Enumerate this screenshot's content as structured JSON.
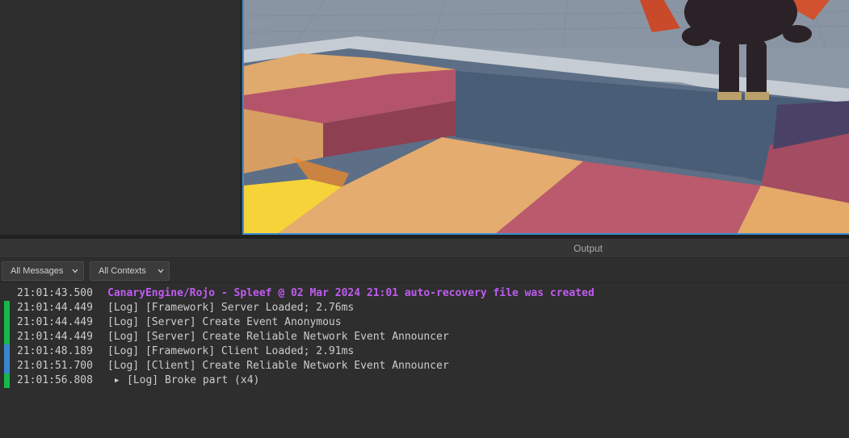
{
  "output": {
    "title": "Output",
    "filters": {
      "messages": "All Messages",
      "contexts": "All Contexts"
    },
    "logs": [
      {
        "time": "21:01:43.500",
        "text": "CanaryEngine/Rojo - Spleef @ 02 Mar 2024 21:01 auto-recovery file was created",
        "kind": "system",
        "bar": ""
      },
      {
        "time": "21:01:44.449",
        "text": "[Log] [Framework] Server Loaded; 2.76ms",
        "kind": "server",
        "bar": "#16b84a"
      },
      {
        "time": "21:01:44.449",
        "text": "[Log] [Server] Create Event Anonymous",
        "kind": "server",
        "bar": "#16b84a"
      },
      {
        "time": "21:01:44.449",
        "text": "[Log] [Server] Create Reliable Network Event Announcer",
        "kind": "server",
        "bar": "#16b84a"
      },
      {
        "time": "21:01:48.189",
        "text": "[Log] [Framework] Client Loaded; 2.91ms",
        "kind": "client",
        "bar": "#3a86d1"
      },
      {
        "time": "21:01:51.700",
        "text": "[Log] [Client] Create Reliable Network Event Announcer",
        "kind": "client",
        "bar": "#3a86d1"
      },
      {
        "time": "21:01:56.808",
        "text": "[Log] Broke part (x4)",
        "kind": "server",
        "bar": "#16b84a",
        "collapsed": true
      }
    ]
  }
}
